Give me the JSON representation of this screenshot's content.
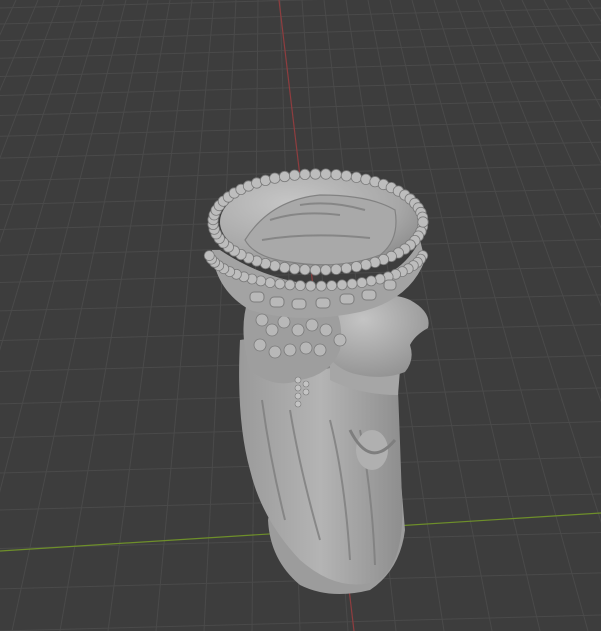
{
  "viewport": {
    "background_color": "#3d3d3d",
    "grid_line_color": "#4a4a4a",
    "x_axis_color": "#8f3d3f",
    "y_axis_color": "#6e8f2a",
    "origin_marker_color": "#4a8ad4",
    "mesh_color": "#a9a9a9",
    "mesh_shadow_color": "#7f7f7f",
    "mesh_highlight_color": "#c8c8c8",
    "object": "bust-sculpture-mesh"
  }
}
